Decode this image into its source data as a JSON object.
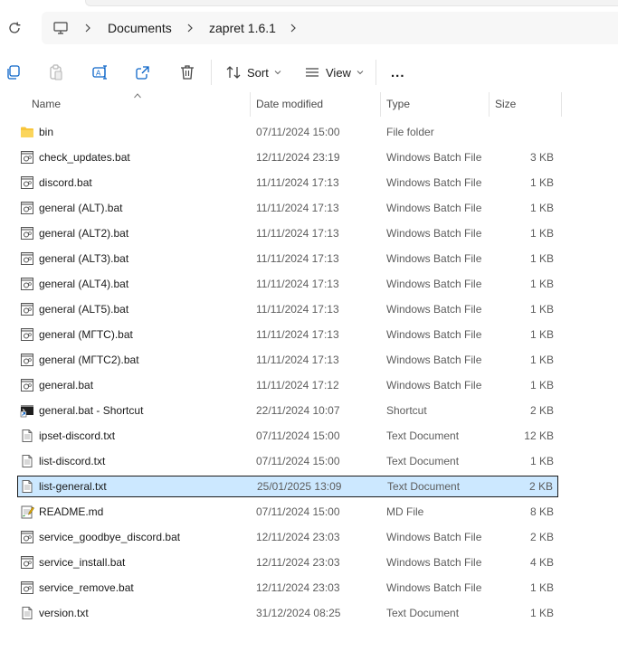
{
  "address": {
    "breadcrumbs": [
      "Documents",
      "zapret 1.6.1"
    ]
  },
  "toolbar": {
    "sort_label": "Sort",
    "view_label": "View",
    "more_label": "..."
  },
  "columns": {
    "name": "Name",
    "date": "Date modified",
    "type": "Type",
    "size": "Size"
  },
  "files": [
    {
      "name": "bin",
      "date": "07/11/2024 15:00",
      "type": "File folder",
      "size": "",
      "icon": "folder-icon"
    },
    {
      "name": "check_updates.bat",
      "date": "12/11/2024 23:19",
      "type": "Windows Batch File",
      "size": "3 KB",
      "icon": "batch-file-icon"
    },
    {
      "name": "discord.bat",
      "date": "11/11/2024 17:13",
      "type": "Windows Batch File",
      "size": "1 KB",
      "icon": "batch-file-icon"
    },
    {
      "name": "general (ALT).bat",
      "date": "11/11/2024 17:13",
      "type": "Windows Batch File",
      "size": "1 KB",
      "icon": "batch-file-icon"
    },
    {
      "name": "general (ALT2).bat",
      "date": "11/11/2024 17:13",
      "type": "Windows Batch File",
      "size": "1 KB",
      "icon": "batch-file-icon"
    },
    {
      "name": "general (ALT3).bat",
      "date": "11/11/2024 17:13",
      "type": "Windows Batch File",
      "size": "1 KB",
      "icon": "batch-file-icon"
    },
    {
      "name": "general (ALT4).bat",
      "date": "11/11/2024 17:13",
      "type": "Windows Batch File",
      "size": "1 KB",
      "icon": "batch-file-icon"
    },
    {
      "name": "general (ALT5).bat",
      "date": "11/11/2024 17:13",
      "type": "Windows Batch File",
      "size": "1 KB",
      "icon": "batch-file-icon"
    },
    {
      "name": "general (МГТС).bat",
      "date": "11/11/2024 17:13",
      "type": "Windows Batch File",
      "size": "1 KB",
      "icon": "batch-file-icon"
    },
    {
      "name": "general (МГТС2).bat",
      "date": "11/11/2024 17:13",
      "type": "Windows Batch File",
      "size": "1 KB",
      "icon": "batch-file-icon"
    },
    {
      "name": "general.bat",
      "date": "11/11/2024 17:12",
      "type": "Windows Batch File",
      "size": "1 KB",
      "icon": "batch-file-icon"
    },
    {
      "name": "general.bat - Shortcut",
      "date": "22/11/2024 10:07",
      "type": "Shortcut",
      "size": "2 KB",
      "icon": "shortcut-icon"
    },
    {
      "name": "ipset-discord.txt",
      "date": "07/11/2024 15:00",
      "type": "Text Document",
      "size": "12 KB",
      "icon": "text-file-icon"
    },
    {
      "name": "list-discord.txt",
      "date": "07/11/2024 15:00",
      "type": "Text Document",
      "size": "1 KB",
      "icon": "text-file-icon"
    },
    {
      "name": "list-general.txt",
      "date": "25/01/2025 13:09",
      "type": "Text Document",
      "size": "2 KB",
      "icon": "text-file-icon",
      "selected": true
    },
    {
      "name": "README.md",
      "date": "07/11/2024 15:00",
      "type": "MD File",
      "size": "8 KB",
      "icon": "markdown-file-icon"
    },
    {
      "name": "service_goodbye_discord.bat",
      "date": "12/11/2024 23:03",
      "type": "Windows Batch File",
      "size": "2 KB",
      "icon": "batch-file-icon"
    },
    {
      "name": "service_install.bat",
      "date": "12/11/2024 23:03",
      "type": "Windows Batch File",
      "size": "4 KB",
      "icon": "batch-file-icon"
    },
    {
      "name": "service_remove.bat",
      "date": "12/11/2024 23:03",
      "type": "Windows Batch File",
      "size": "1 KB",
      "icon": "batch-file-icon"
    },
    {
      "name": "version.txt",
      "date": "31/12/2024 08:25",
      "type": "Text Document",
      "size": "1 KB",
      "icon": "text-file-icon"
    }
  ],
  "colors": {
    "selection_bg": "#cce8ff",
    "folder_yellow": "#f8c53a",
    "icon_blue": "#0a64c8"
  }
}
